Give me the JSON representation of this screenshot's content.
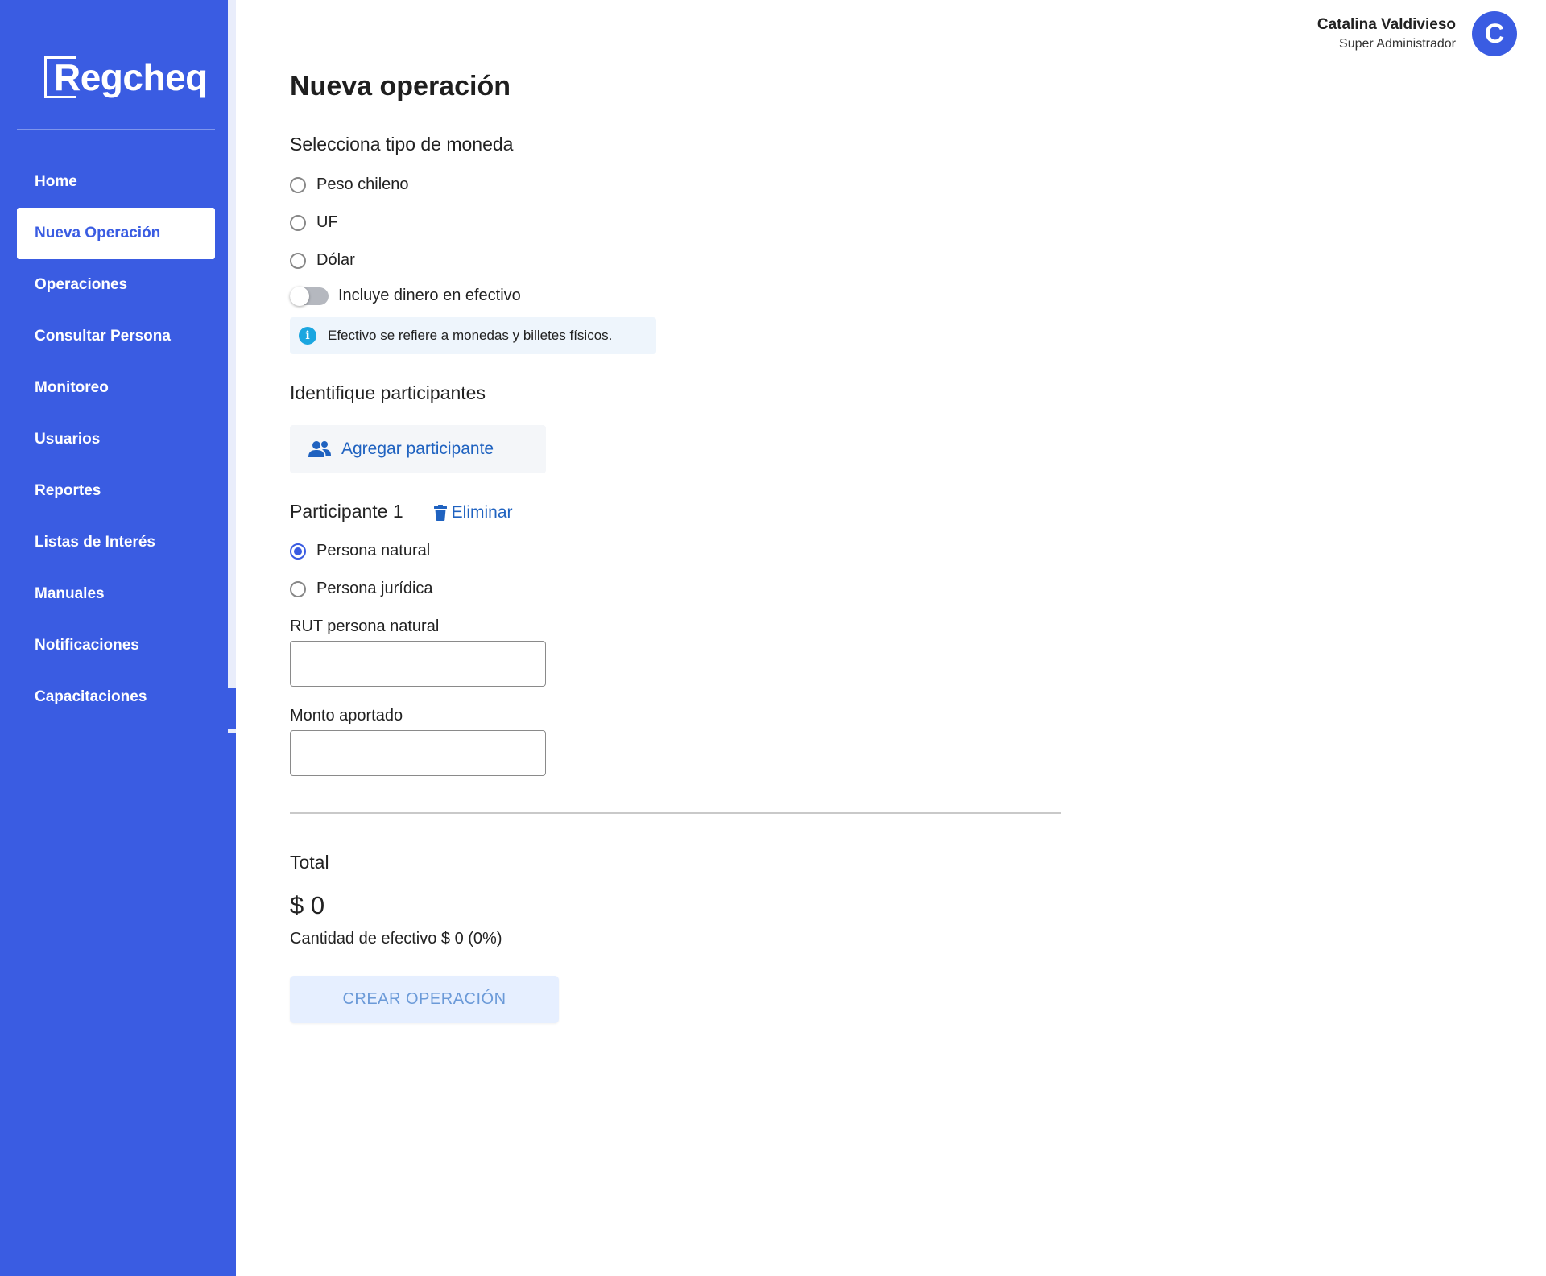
{
  "app": {
    "logo_text": "Regcheq"
  },
  "sidebar": {
    "items": [
      {
        "label": "Home"
      },
      {
        "label": "Nueva Operación"
      },
      {
        "label": "Operaciones"
      },
      {
        "label": "Consultar Persona"
      },
      {
        "label": "Monitoreo"
      },
      {
        "label": "Usuarios"
      },
      {
        "label": "Reportes"
      },
      {
        "label": "Listas de Interés"
      },
      {
        "label": "Manuales"
      },
      {
        "label": "Notificaciones"
      },
      {
        "label": "Capacitaciones"
      }
    ],
    "active_index": 1
  },
  "user": {
    "name": "Catalina Valdivieso",
    "role": "Super Administrador",
    "avatar_letter": "C"
  },
  "page": {
    "title": "Nueva operación"
  },
  "currency": {
    "section_title": "Selecciona tipo de moneda",
    "options": [
      {
        "label": "Peso chileno",
        "checked": false
      },
      {
        "label": "UF",
        "checked": false
      },
      {
        "label": "Dólar",
        "checked": false
      }
    ],
    "cash_toggle_label": "Incluye dinero en efectivo",
    "cash_toggle_on": false,
    "info_icon_char": "i",
    "info_text": "Efectivo se refiere a monedas y billetes físicos."
  },
  "participants": {
    "section_title": "Identifique participantes",
    "add_button_label": "Agregar participante",
    "items": [
      {
        "title": "Participante 1",
        "delete_label": "Eliminar",
        "type_options": [
          {
            "label": "Persona natural",
            "checked": true
          },
          {
            "label": "Persona jurídica",
            "checked": false
          }
        ],
        "rut_label": "RUT persona natural",
        "rut_value": "",
        "amount_label": "Monto aportado",
        "amount_value": ""
      }
    ]
  },
  "summary": {
    "total_label": "Total",
    "total_value": "$ 0",
    "cash_amount_text": "Cantidad de efectivo $ 0 (0%)",
    "create_button_label": "CREAR OPERACIÓN"
  },
  "colors": {
    "brand": "#3a5ce2",
    "link": "#1f62c0",
    "info_icon": "#1ba6e0",
    "info_bg": "#eef5fc",
    "button_disabled_bg": "#e6efff",
    "button_disabled_text": "#6b9ad8"
  },
  "icons": {
    "add_participant": "users-icon",
    "delete": "trash-icon",
    "info": "info-icon"
  }
}
